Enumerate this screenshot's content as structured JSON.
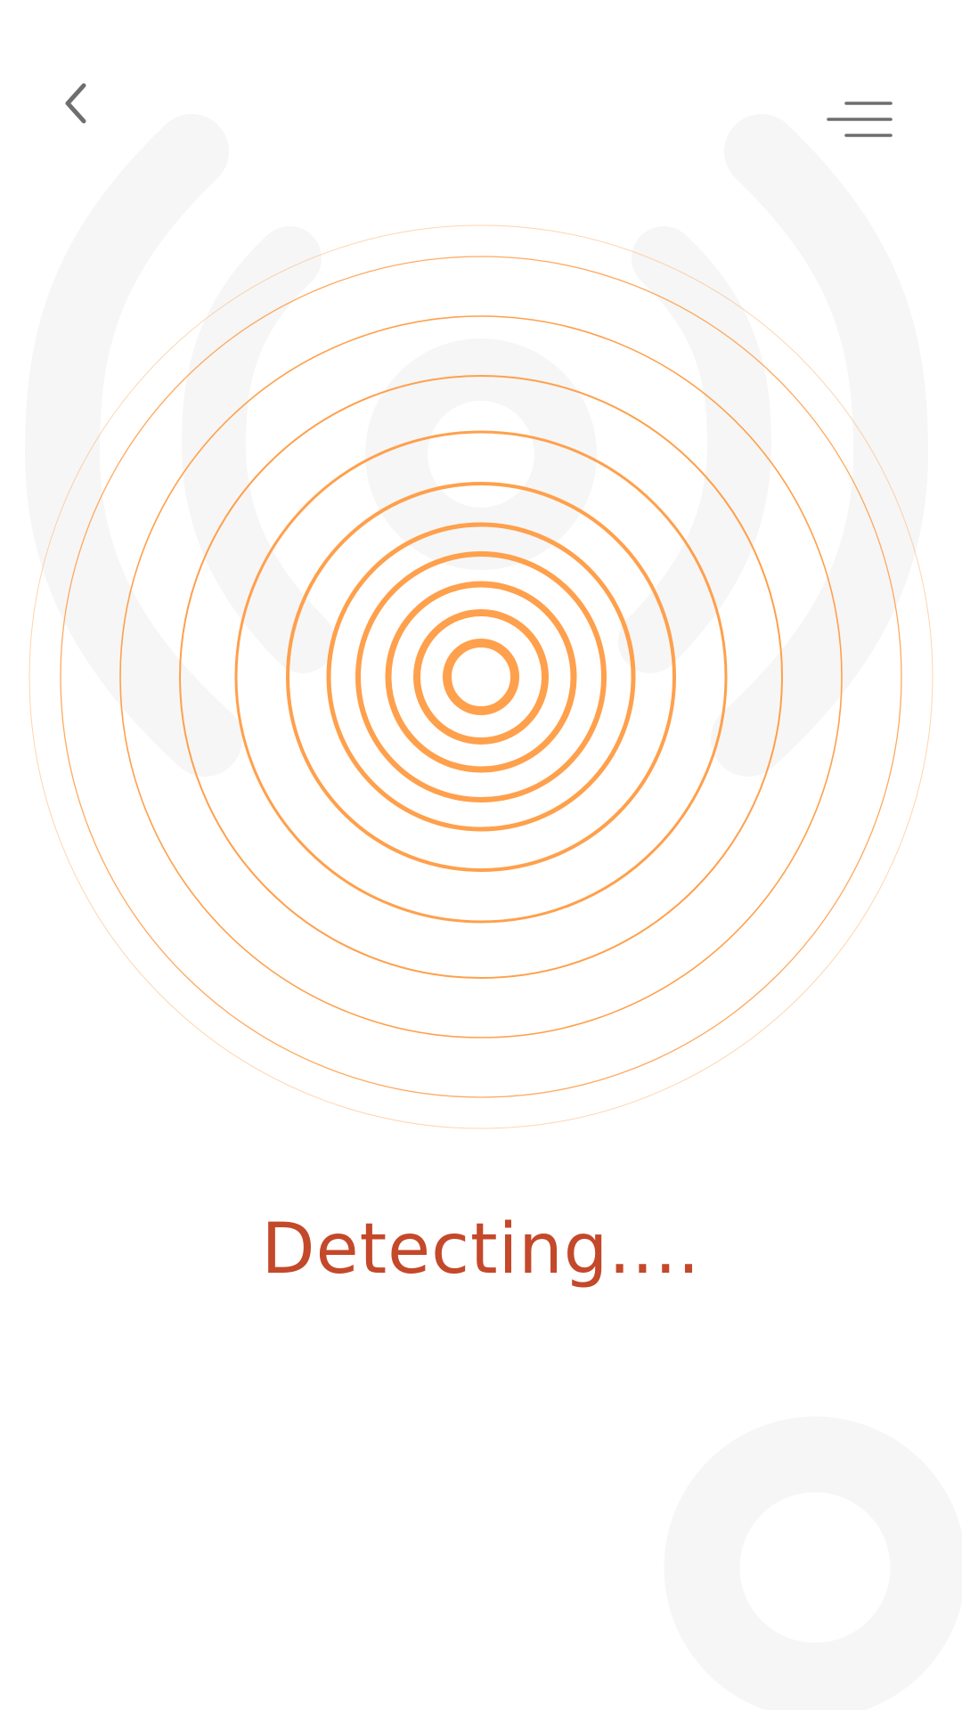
{
  "header": {
    "back_icon": "chevron-left-icon",
    "menu_icon": "hamburger-menu-icon"
  },
  "detector": {
    "ring_count": 11,
    "icon": "radar-rings-icon"
  },
  "status": {
    "label": "Detecting...."
  },
  "colors": {
    "accent": "#FFA04C",
    "status_text": "#C4482A",
    "icon": "#6E6E6E",
    "decor": "#F6F6F6"
  }
}
